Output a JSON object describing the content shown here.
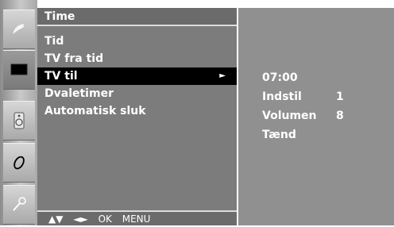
{
  "menu": {
    "title": "Time",
    "items": [
      {
        "label": "Tid"
      },
      {
        "label": "TV fra tid"
      },
      {
        "label": "TV til",
        "arrow": "►"
      },
      {
        "label": "Dvaletimer"
      },
      {
        "label": "Automatisk sluk"
      }
    ],
    "selected_index": 2
  },
  "footer": {
    "updown": "▲▼",
    "leftright": "◄►",
    "ok": "OK",
    "menu": "MENU"
  },
  "submenu": {
    "time": "07:00",
    "input_label": "Indstil",
    "input_value": "1",
    "volume_label": "Volumen",
    "volume_value": "8",
    "power": "Tænd"
  },
  "icons": [
    "satellite-dish-icon",
    "screen-icon",
    "speaker-icon",
    "clock-icon",
    "settings-key-icon"
  ],
  "colors": {
    "panel": "#7c7c7c",
    "submenu_panel": "#909090",
    "selected_row": "#000000",
    "text": "#ffffff"
  }
}
